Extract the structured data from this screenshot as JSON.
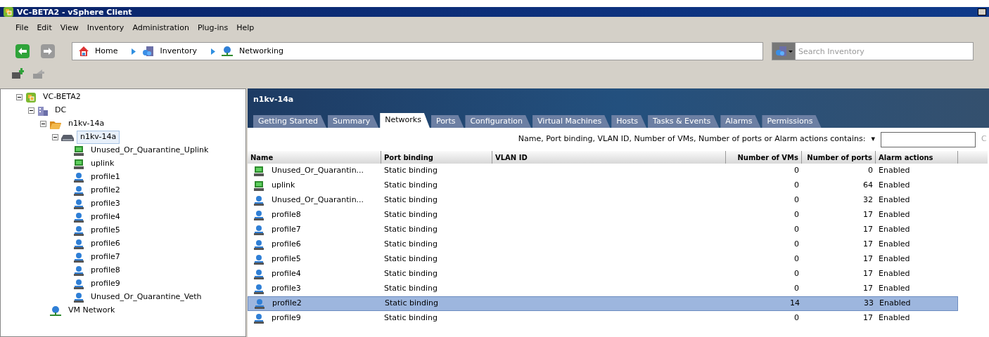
{
  "window": {
    "title": "VC-BETA2 - vSphere Client"
  },
  "menu": [
    "File",
    "Edit",
    "View",
    "Inventory",
    "Administration",
    "Plug-ins",
    "Help"
  ],
  "breadcrumb": [
    {
      "label": "Home",
      "kind": "home"
    },
    {
      "label": "Inventory",
      "kind": "inventory"
    },
    {
      "label": "Networking",
      "kind": "network"
    }
  ],
  "search": {
    "placeholder": "Search Inventory"
  },
  "tree": [
    {
      "label": "VC-BETA2",
      "kind": "vcenter",
      "expanded": true,
      "selected": false,
      "children": [
        {
          "label": "DC",
          "kind": "datacenter",
          "expanded": true,
          "selected": false,
          "children": [
            {
              "label": "n1kv-14a",
              "kind": "folder",
              "expanded": true,
              "selected": false,
              "children": [
                {
                  "label": "n1kv-14a",
                  "kind": "switch",
                  "expanded": true,
                  "selected": true,
                  "children": [
                    {
                      "label": "Unused_Or_Quarantine_Uplink",
                      "kind": "uplink",
                      "selected": false
                    },
                    {
                      "label": "uplink",
                      "kind": "uplink",
                      "selected": false
                    },
                    {
                      "label": "profile1",
                      "kind": "portgroup",
                      "selected": false
                    },
                    {
                      "label": "profile2",
                      "kind": "portgroup",
                      "selected": false
                    },
                    {
                      "label": "profile3",
                      "kind": "portgroup",
                      "selected": false
                    },
                    {
                      "label": "profile4",
                      "kind": "portgroup",
                      "selected": false
                    },
                    {
                      "label": "profile5",
                      "kind": "portgroup",
                      "selected": false
                    },
                    {
                      "label": "profile6",
                      "kind": "portgroup",
                      "selected": false
                    },
                    {
                      "label": "profile7",
                      "kind": "portgroup",
                      "selected": false
                    },
                    {
                      "label": "profile8",
                      "kind": "portgroup",
                      "selected": false
                    },
                    {
                      "label": "profile9",
                      "kind": "portgroup",
                      "selected": false
                    },
                    {
                      "label": "Unused_Or_Quarantine_Veth",
                      "kind": "portgroup",
                      "selected": false
                    }
                  ]
                }
              ]
            },
            {
              "label": "VM Network",
              "kind": "network",
              "selected": false
            }
          ]
        }
      ]
    }
  ],
  "panel": {
    "title": "n1kv-14a",
    "tabs": [
      {
        "label": "Getting Started",
        "selected": false
      },
      {
        "label": "Summary",
        "selected": false
      },
      {
        "label": "Networks",
        "selected": true
      },
      {
        "label": "Ports",
        "selected": false
      },
      {
        "label": "Configuration",
        "selected": false
      },
      {
        "label": "Virtual Machines",
        "selected": false
      },
      {
        "label": "Hosts",
        "selected": false
      },
      {
        "label": "Tasks & Events",
        "selected": false
      },
      {
        "label": "Alarms",
        "selected": false
      },
      {
        "label": "Permissions",
        "selected": false
      }
    ],
    "filter": {
      "label": "Name, Port binding, VLAN ID, Number of VMs, Number of ports or Alarm actions contains:",
      "caret": "▾",
      "clear": "C"
    },
    "table": {
      "columns": [
        "Name",
        "Port binding",
        "VLAN ID",
        "Number of VMs",
        "Number of ports",
        "Alarm actions"
      ],
      "rows": [
        {
          "kind": "uplink",
          "name": "Unused_Or_Quarantin...",
          "binding": "Static binding",
          "vms": "0",
          "ports": "0",
          "alarm": "Enabled",
          "selected": false
        },
        {
          "kind": "uplink",
          "name": "uplink",
          "binding": "Static binding",
          "vms": "0",
          "ports": "64",
          "alarm": "Enabled",
          "selected": false
        },
        {
          "kind": "portgroup",
          "name": "Unused_Or_Quarantin...",
          "binding": "Static binding",
          "vms": "0",
          "ports": "32",
          "alarm": "Enabled",
          "selected": false
        },
        {
          "kind": "portgroup",
          "name": "profile8",
          "binding": "Static binding",
          "vms": "0",
          "ports": "17",
          "alarm": "Enabled",
          "selected": false
        },
        {
          "kind": "portgroup",
          "name": "profile7",
          "binding": "Static binding",
          "vms": "0",
          "ports": "17",
          "alarm": "Enabled",
          "selected": false
        },
        {
          "kind": "portgroup",
          "name": "profile6",
          "binding": "Static binding",
          "vms": "0",
          "ports": "17",
          "alarm": "Enabled",
          "selected": false
        },
        {
          "kind": "portgroup",
          "name": "profile5",
          "binding": "Static binding",
          "vms": "0",
          "ports": "17",
          "alarm": "Enabled",
          "selected": false
        },
        {
          "kind": "portgroup",
          "name": "profile4",
          "binding": "Static binding",
          "vms": "0",
          "ports": "17",
          "alarm": "Enabled",
          "selected": false
        },
        {
          "kind": "portgroup",
          "name": "profile3",
          "binding": "Static binding",
          "vms": "0",
          "ports": "17",
          "alarm": "Enabled",
          "selected": false
        },
        {
          "kind": "portgroup",
          "name": "profile2",
          "binding": "Static binding",
          "vms": "14",
          "ports": "33",
          "alarm": "Enabled",
          "selected": true
        },
        {
          "kind": "portgroup",
          "name": "profile9",
          "binding": "Static binding",
          "vms": "0",
          "ports": "17",
          "alarm": "Enabled",
          "selected": false
        }
      ]
    }
  }
}
